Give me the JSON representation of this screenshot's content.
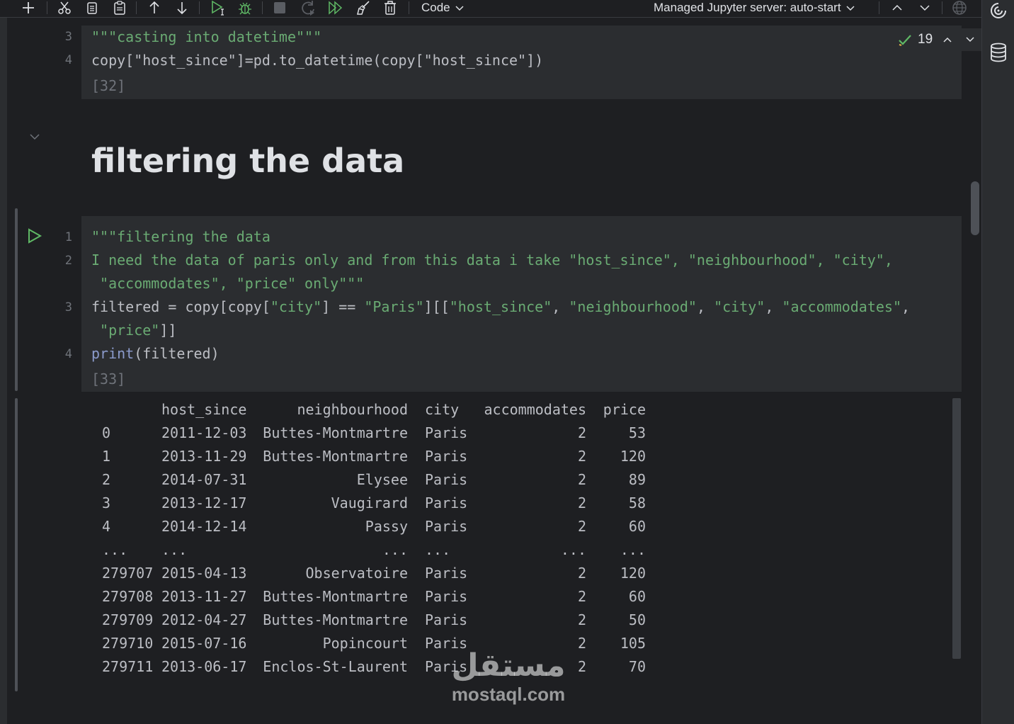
{
  "toolbar": {
    "cell_type": "Code",
    "server_status": "Managed Jupyter server: auto-start"
  },
  "inspection": {
    "count": "19"
  },
  "cell_prev": {
    "lines": [
      {
        "num": "3",
        "text": "\"\"\"casting into datetime\"\"\""
      },
      {
        "num": "4",
        "text": "copy[\"host_since\"]=pd.to_datetime(copy[\"host_since\"])"
      }
    ],
    "exec_count": "[32]"
  },
  "markdown": {
    "heading": "filtering the data"
  },
  "cell_main": {
    "lines": [
      {
        "num": "1",
        "text": "\"\"\"filtering the data"
      },
      {
        "num": "2",
        "text": "I need the data of paris only and from this data i take \"host_since\", \"neighbourhood\", \"city\","
      },
      {
        "num": "",
        "text": " \"accommodates\", \"price\" only\"\"\""
      },
      {
        "num": "3",
        "text": "filtered = copy[copy[\"city\"] == \"Paris\"][[\"host_since\", \"neighbourhood\", \"city\", \"accommodates\","
      },
      {
        "num": "",
        "text": " \"price\"]]"
      },
      {
        "num": "4",
        "text": "print(filtered)"
      }
    ],
    "exec_count": "[33]"
  },
  "output": {
    "columns": [
      "",
      "host_since",
      "neighbourhood",
      "city",
      "accommodates",
      "price"
    ],
    "rows": [
      [
        "0",
        "2011-12-03",
        "Buttes-Montmartre",
        "Paris",
        "2",
        "53"
      ],
      [
        "1",
        "2013-11-29",
        "Buttes-Montmartre",
        "Paris",
        "2",
        "120"
      ],
      [
        "2",
        "2014-07-31",
        "Elysee",
        "Paris",
        "2",
        "89"
      ],
      [
        "3",
        "2013-12-17",
        "Vaugirard",
        "Paris",
        "2",
        "58"
      ],
      [
        "4",
        "2014-12-14",
        "Passy",
        "Paris",
        "2",
        "60"
      ],
      [
        "...",
        "...",
        "...",
        "...",
        "...",
        "..."
      ],
      [
        "279707",
        "2015-04-13",
        "Observatoire",
        "Paris",
        "2",
        "120"
      ],
      [
        "279708",
        "2013-11-27",
        "Buttes-Montmartre",
        "Paris",
        "2",
        "60"
      ],
      [
        "279709",
        "2012-04-27",
        "Buttes-Montmartre",
        "Paris",
        "2",
        "50"
      ],
      [
        "279710",
        "2015-07-16",
        "Popincourt",
        "Paris",
        "2",
        "105"
      ],
      [
        "279711",
        "2013-06-17",
        "Enclos-St-Laurent",
        "Paris",
        "2",
        "70"
      ]
    ]
  },
  "watermark": {
    "arabic": "مستقل",
    "latin": "mostaql.com"
  },
  "colors": {
    "string": "#6aab73",
    "builtin": "#8b9bcc",
    "run": "#5fb865",
    "check": "#5fb865"
  }
}
